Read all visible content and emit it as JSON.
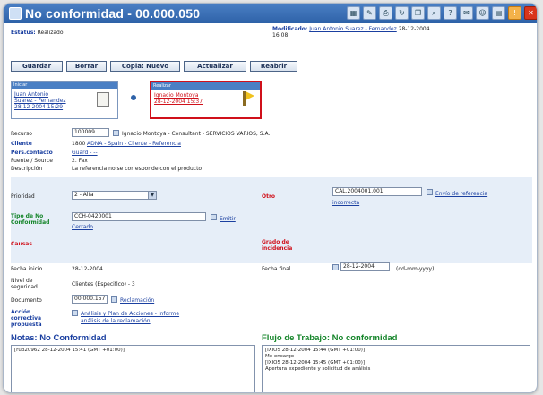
{
  "window": {
    "title": "No conformidad - 00.000.050"
  },
  "header": {
    "estado_label": "Estatus:",
    "estado_value": "Realizado",
    "modificado_label": "Modificado:",
    "modificado_user": "Juan Antonio Suarez - Fernandez",
    "modificado_date": "28-12-2004",
    "modificado_time": "16:08"
  },
  "toolbar": {
    "guardar": "Guardar",
    "borrar": "Borrar",
    "copia_nuevo": "Copia: Nuevo",
    "actualizar": "Actualizar",
    "reabrir": "Reabrir"
  },
  "workflow": {
    "card1_head": "Iniciar",
    "card1_line1": "Juan Antonio",
    "card1_line2": "Suarez - Fernandez",
    "card1_line3": "28-12-2004 15:29",
    "card2_head": "Realizar",
    "card2_line1": "Ignacio Montoya",
    "card2_line2": "28-12-2004 15:37"
  },
  "form": {
    "recurso_label": "Recurso",
    "recurso_value": "100009",
    "recurso_desc": "Ignacio Montoya - Consultant - SERVICIOS VARIOS, S.A.",
    "cliente_label": "Cliente",
    "cliente_value": "1800",
    "cliente_link": "ADNA - Spain - Cliente - Referencia",
    "perscontacto_label": "Pers.contacto",
    "perscontacto_value": "Guard - --",
    "fuente_label": "Fuente / Source",
    "fuente_value": "2. Fax",
    "descripcion_label": "Descripción",
    "descripcion_value": "La referencia no se corresponde con el producto",
    "prioridad_label": "Prioridad",
    "prioridad_value": "2 - Alta",
    "otro_label": "Otro",
    "otro_value": "CAL.2004001.001",
    "otro_link": "Envío de referencia",
    "otro_link2": "incorrecta",
    "tipo_label": "Tipo de No",
    "tipo_label2": "Conformidad",
    "tipo_value": "CCH-0420001",
    "tipo_link": "Emitir",
    "tipo_sub": "Cerrado",
    "causas_label": "Causas",
    "grado_label": "Grado de",
    "grado_label2": "incidencia",
    "fecha_inicio_label": "Fecha inicio",
    "fecha_inicio_value": "28-12-2004",
    "fecha_final_label": "Fecha final",
    "fecha_final_value": "28-12-2004",
    "fecha_fmt": "(dd-mm-yyyy)",
    "nivel_label": "Nivel de",
    "nivel_label2": "seguridad",
    "nivel_value": "Clientes (Especifico) - 3",
    "documento_label": "Documento",
    "documento_value": "00.000.157",
    "documento_link": "Reclamación",
    "accion_label": "Acción",
    "accion_label2": "correctiva",
    "accion_label3": "propuesta",
    "accion_link": "Análisis y Plan de Acciones - Informe",
    "accion_link2": "análisis de la reclamación"
  },
  "notes": {
    "title": "Notas: No Conformidad",
    "content": "[rub20962 28-12-2004 15:41 (GMT +01:00)]"
  },
  "flow": {
    "title": "Flujo de Trabajo: No conformidad",
    "content": "[IXIO5 28-12-2004 15:44 (GMT +01:00)]\nMe encargo\n[IXIO5 28-12-2004 15:45 (GMT +01:00)]\nApertura expediente y solicitud de análisis"
  },
  "colors": {
    "titlebar": "#2e62a8",
    "accent_blue": "#1a3fa0",
    "green_label": "#15852a",
    "red_label": "#d0101a",
    "highlight_border": "#d0101a"
  },
  "icons": {
    "titlebar": [
      "window-icon",
      "grid-icon",
      "edit-icon",
      "print-icon",
      "refresh-icon",
      "copy-icon",
      "search-icon",
      "help-icon",
      "mail-icon",
      "user-icon",
      "folder-icon",
      "warning-icon",
      "close-icon"
    ]
  }
}
